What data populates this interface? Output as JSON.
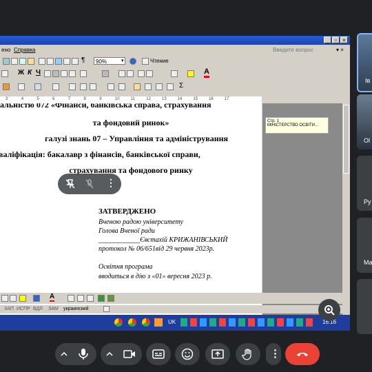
{
  "word": {
    "menu": {
      "view": "ено",
      "help": "Справка",
      "ask": "Введите вопрос"
    },
    "zoom": "90%",
    "reading": "Чтение",
    "font_buttons": {
      "bold": "Ж",
      "italic": "К",
      "underline": "Ч"
    },
    "ruler_marks": [
      "3",
      "4",
      "5",
      "6",
      "7",
      "8",
      "9",
      "10",
      "11",
      "12",
      "13",
      "14",
      "15",
      "16",
      "17"
    ],
    "document": {
      "line1": "альністю  072 «Фінанси, банківська справа, страхування",
      "line2": "та фондовий ринок»",
      "line3": "галузі знань 07 – Управління та адміністрування",
      "line4": "валіфікація: бакалавр з фінансів, банківської справи,",
      "line5": "страхування та фондового ринку",
      "approved": "ЗАТВЕРДЖЕНО",
      "council": "Вченою радою університету",
      "chair": "Голова Вченої ради",
      "signature": "____________Євстахій КРИЖАНІВСЬКИЙ",
      "protocol": "протокол № 06/651від 29 червня   2023р.",
      "program": "Освітня програма",
      "effective": "вводиться в дію з «01» вересня  2023 р."
    },
    "comment": {
      "page": "Стр. 1",
      "text": "МІНІСТЕРСТВО ОСВІТИ..."
    },
    "status": {
      "zap": "ЗАП",
      "ispr": "ИСПР",
      "vdl": "ВДЛ",
      "zam": "ЗАМ",
      "lang": "украинский"
    },
    "taskbar": {
      "lang": "UK",
      "time": "16:16"
    }
  },
  "overlay": {
    "mic_off": "mic-off-icon",
    "more": "⋮"
  },
  "participants": [
    {
      "name": "Ів"
    },
    {
      "name": "Ol"
    },
    {
      "name": "Ру"
    },
    {
      "name": "Ма"
    },
    {
      "name": ""
    }
  ],
  "colors": {
    "call_red": "#ea4335",
    "meet_bg": "#202124",
    "button_bg": "#3c4043",
    "active_border": "#8ab4f8"
  }
}
